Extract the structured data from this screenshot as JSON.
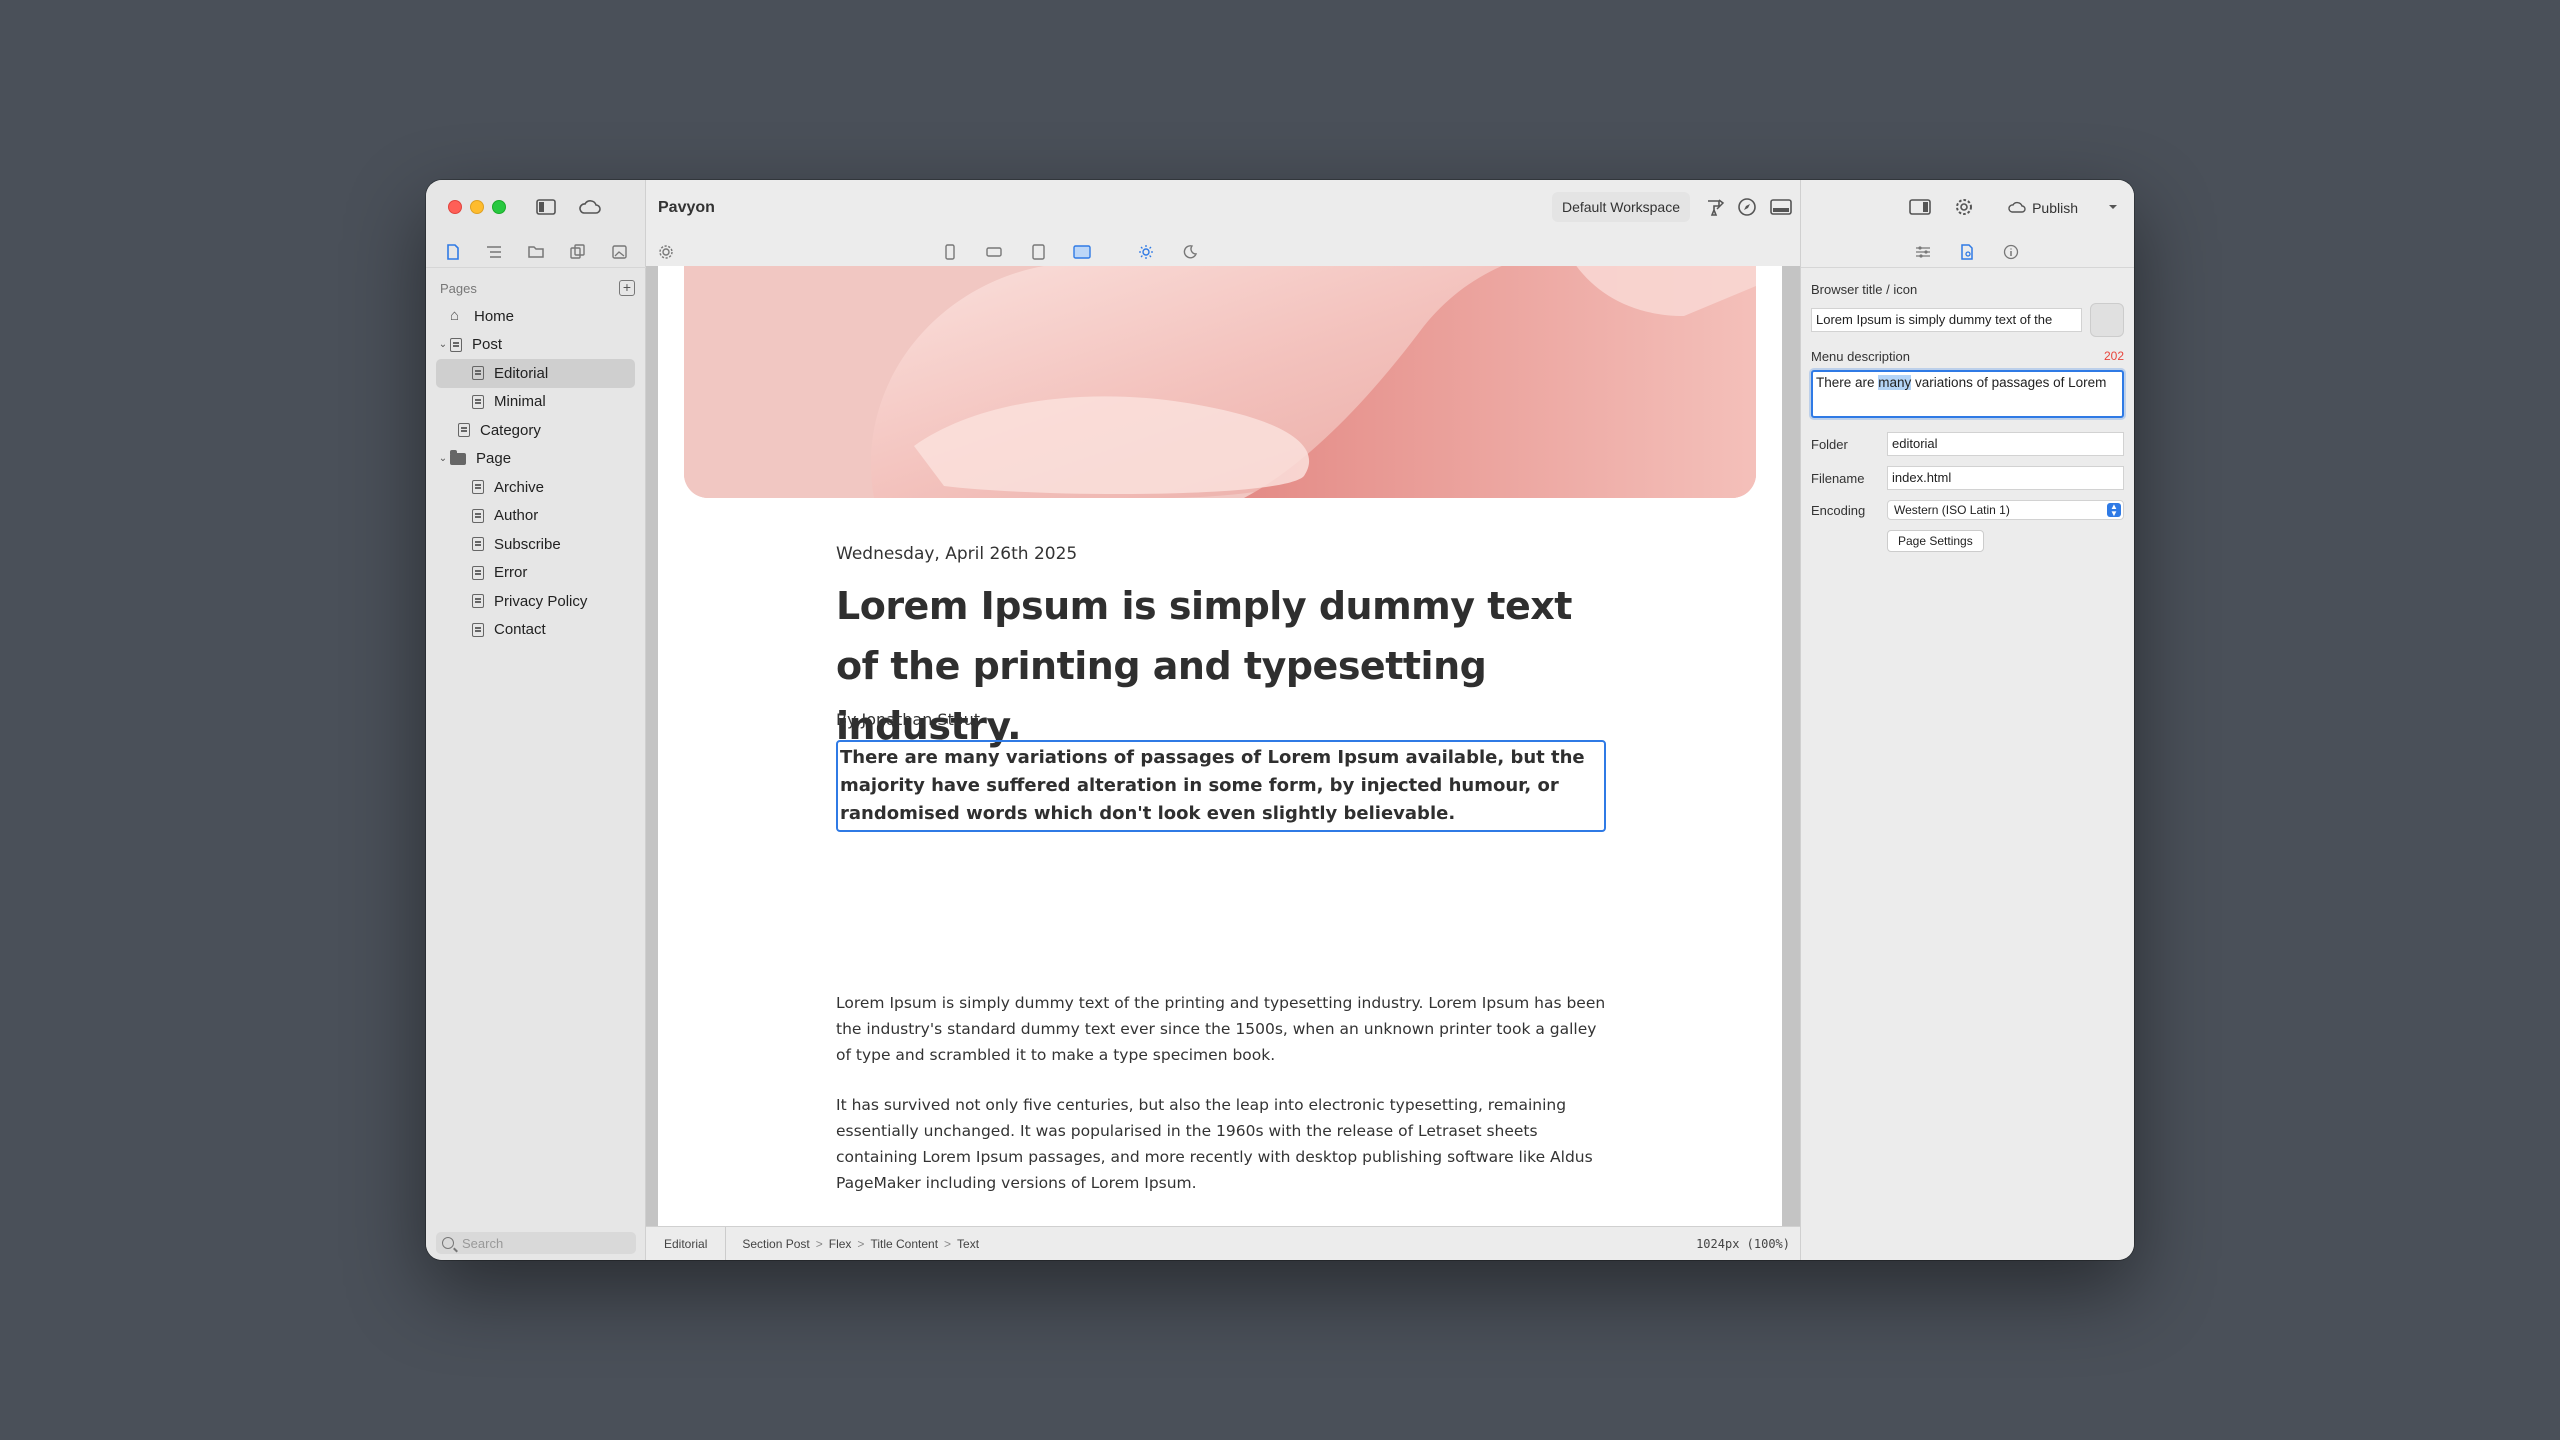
{
  "app": {
    "title": "Pavyon"
  },
  "sidebar": {
    "section_title": "Pages",
    "search_placeholder": "Search",
    "items": [
      {
        "label": "Home",
        "icon": "home-icon"
      },
      {
        "label": "Post",
        "icon": "page-icon",
        "expanded": true
      },
      {
        "label": "Editorial",
        "icon": "page-icon",
        "selected": true
      },
      {
        "label": "Minimal",
        "icon": "page-icon"
      },
      {
        "label": "Category",
        "icon": "page-icon"
      },
      {
        "label": "Page",
        "icon": "folder-icon",
        "expanded": true
      },
      {
        "label": "Archive",
        "icon": "page-icon"
      },
      {
        "label": "Author",
        "icon": "page-icon"
      },
      {
        "label": "Subscribe",
        "icon": "page-icon"
      },
      {
        "label": "Error",
        "icon": "page-icon"
      },
      {
        "label": "Privacy Policy",
        "icon": "page-icon"
      },
      {
        "label": "Contact",
        "icon": "page-icon"
      }
    ]
  },
  "toolbar": {
    "workspace": "Default Workspace",
    "publish": "Publish"
  },
  "article": {
    "date": "Wednesday, April 26th 2025",
    "headline": "Lorem Ipsum is simply dummy text of the printing and typesetting industry.",
    "byline": "By Jonathan Stout",
    "excerpt": "There are many variations of passages of Lorem Ipsum available, but the majority have suffered alteration in some form, by injected humour, or randomised words which don't look even slightly believable.",
    "para1": "Lorem Ipsum is simply dummy text of the printing and typesetting industry. Lorem Ipsum has been the industry's standard dummy text ever since the 1500s, when an unknown printer took a galley of type and scrambled it to make a type specimen book.",
    "para2": "It has survived not only five centuries, but also the leap into electronic typesetting, remaining essentially unchanged. It was popularised in the 1960s with the release of Letraset sheets containing Lorem Ipsum passages, and more recently with desktop publishing software like Aldus PageMaker including versions of Lorem Ipsum."
  },
  "status": {
    "page": "Editorial",
    "breadcrumb": [
      "Section Post",
      "Flex",
      "Title Content",
      "Text"
    ],
    "size": "1024px  (100%)"
  },
  "inspector": {
    "browser_title_label": "Browser title / icon",
    "browser_title_value": "Lorem Ipsum is simply dummy text of the",
    "menu_description_label": "Menu description",
    "menu_description_count": "202",
    "menu_description_pre": "There are ",
    "menu_description_sel": "many",
    "menu_description_post": " variations of passages of Lorem",
    "folder_label": "Folder",
    "folder_value": "editorial",
    "filename_label": "Filename",
    "filename_value": "index.html",
    "encoding_label": "Encoding",
    "encoding_value": "Western (ISO Latin 1)",
    "page_settings": "Page Settings"
  },
  "colors": {
    "accent": "#2f7ae5",
    "counter": "#e8453c",
    "desktop": "#4a5059"
  }
}
